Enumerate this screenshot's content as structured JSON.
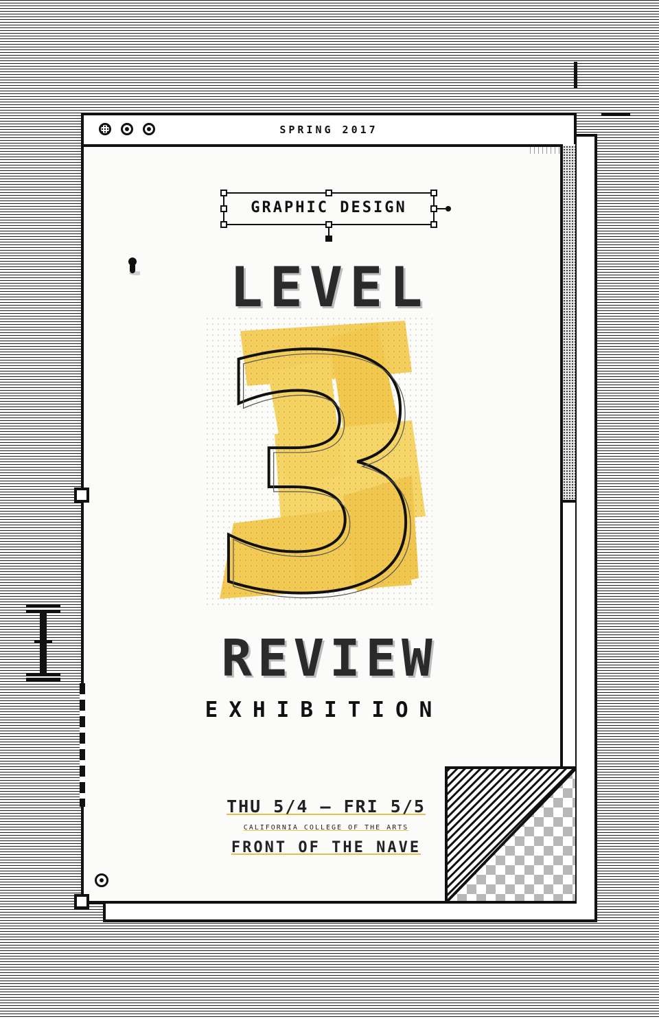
{
  "window": {
    "title": "SPRING 2017",
    "icons": [
      "halftone-dot-icon",
      "ring-dot-icon",
      "ring-dot-icon"
    ]
  },
  "poster": {
    "label": "GRAPHIC DESIGN",
    "headline_top": "LEVEL",
    "number": "3",
    "headline_bottom": "REVIEW",
    "subtitle": "EXHIBITION",
    "dates": "THU 5/4 – FRI 5/5",
    "school": "CALIFORNIA COLLEGE OF THE ARTS",
    "venue": "FRONT OF THE NAVE"
  },
  "colors": {
    "accent_yellow": "#f2c230",
    "ink": "#111111",
    "paper": "#fbfbfa"
  }
}
